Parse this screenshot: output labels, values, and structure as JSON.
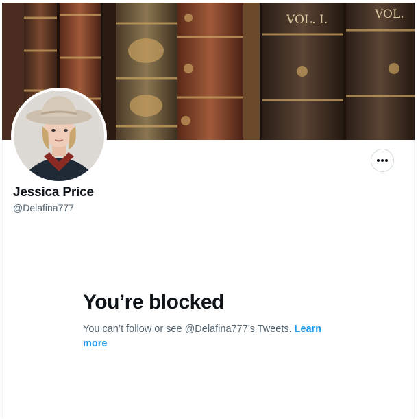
{
  "profile": {
    "display_name": "Jessica Price",
    "handle": "@Delafina777"
  },
  "banner": {
    "book_labels": [
      "VOL. I.",
      "VOL."
    ]
  },
  "icons": {
    "more": "more-horizontal-icon"
  },
  "blocked": {
    "title": "You’re blocked",
    "message": "You can’t follow or see @Delafina777’s Tweets.",
    "link_label": "Learn more"
  },
  "colors": {
    "primary_text": "#0f1419",
    "secondary_text": "#536471",
    "link": "#1d9bf0",
    "border": "#cfd9de"
  }
}
